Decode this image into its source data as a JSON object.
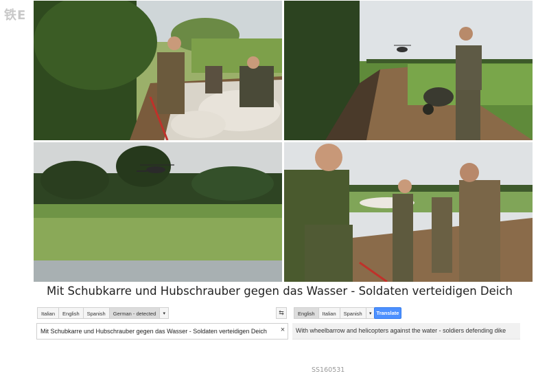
{
  "watermark": "铁E",
  "photos": [
    {
      "name": "sandbag-soldiers-photo"
    },
    {
      "name": "wheelbarrow-helicopter-photo"
    },
    {
      "name": "helicopter-over-field-photo"
    },
    {
      "name": "soldiers-on-dike-photo"
    }
  ],
  "caption": "Mit Schubkarre und Hubschrauber gegen das Wasser - Soldaten verteidigen Deich",
  "translate": {
    "source_langs": [
      "Italian",
      "English",
      "Spanish",
      "German - detected"
    ],
    "target_langs": [
      "English",
      "Italian",
      "Spanish"
    ],
    "swap_icon": "swap-icon",
    "translate_label": "Translate",
    "source_text": "Mit Schubkarre und Hubschrauber gegen das Wasser - Soldaten verteidigen Deich",
    "clear_label": "×",
    "translated_text": "With wheelbarrow and helicopters against the water - soldiers defending dike"
  },
  "footer_code": "SS160531"
}
